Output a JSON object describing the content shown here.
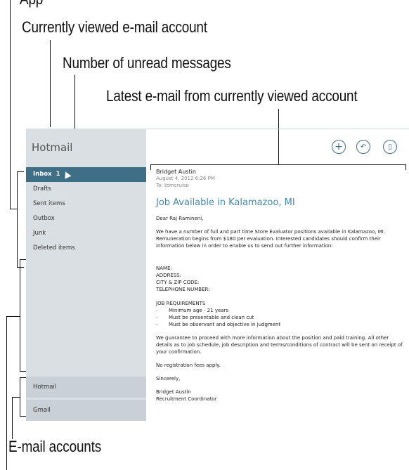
{
  "callouts": {
    "app_top": "App",
    "currently_viewed": "Currently viewed e-mail account",
    "unread": "Number of unread messages",
    "latest": "Latest e-mail from currently viewed account",
    "accounts": "E-mail accounts"
  },
  "app_title": "Hotmail",
  "folders": [
    {
      "label": "Inbox",
      "count": "1",
      "active": true
    },
    {
      "label": "Drafts"
    },
    {
      "label": "Sent items"
    },
    {
      "label": "Outbox"
    },
    {
      "label": "Junk"
    },
    {
      "label": "Deleted items"
    }
  ],
  "accounts": [
    "Hotmail",
    "Gmail"
  ],
  "toolbar": {
    "new_icon": "plus-icon",
    "respond_icon": "respond-icon",
    "delete_icon": "trash-icon",
    "accent": "#3f6f87"
  },
  "message": {
    "sender": "Bridget Austin",
    "date": "August 4, 2012  6:26 PM",
    "to": "To: tomcruise",
    "subject": "Job Available in Kalamazoo, MI",
    "greeting": "Dear Raj Ramineni,",
    "para1": "We have a number of full and part time Store Evaluator positions available in Kalamazoo, MI. Remuneration begins from $180 per evaluation. Interested candidates should confirm their information below in order to enable us to send out further information:",
    "fields": [
      "NAME:",
      "ADDRESS:",
      "CITY & ZIP CODE:",
      "TELEPHONE NUMBER:"
    ],
    "req_title": "JOB REQUIREMENTS",
    "requirements": [
      "Minimum age - 21 years",
      "Must be presentable and clean cut",
      "Must be observant and objective in judgment"
    ],
    "para2": "We guarantee to proceed with more information about the position and paid training. All other details as to job schedule, job description and terms/conditions of contract will be sent on receipt of your confirmation.",
    "note": "No registration fees apply.",
    "closing": "Sincerely,",
    "sig_name": "Bridget Austin",
    "sig_title": "Recruitment Coordinator"
  }
}
